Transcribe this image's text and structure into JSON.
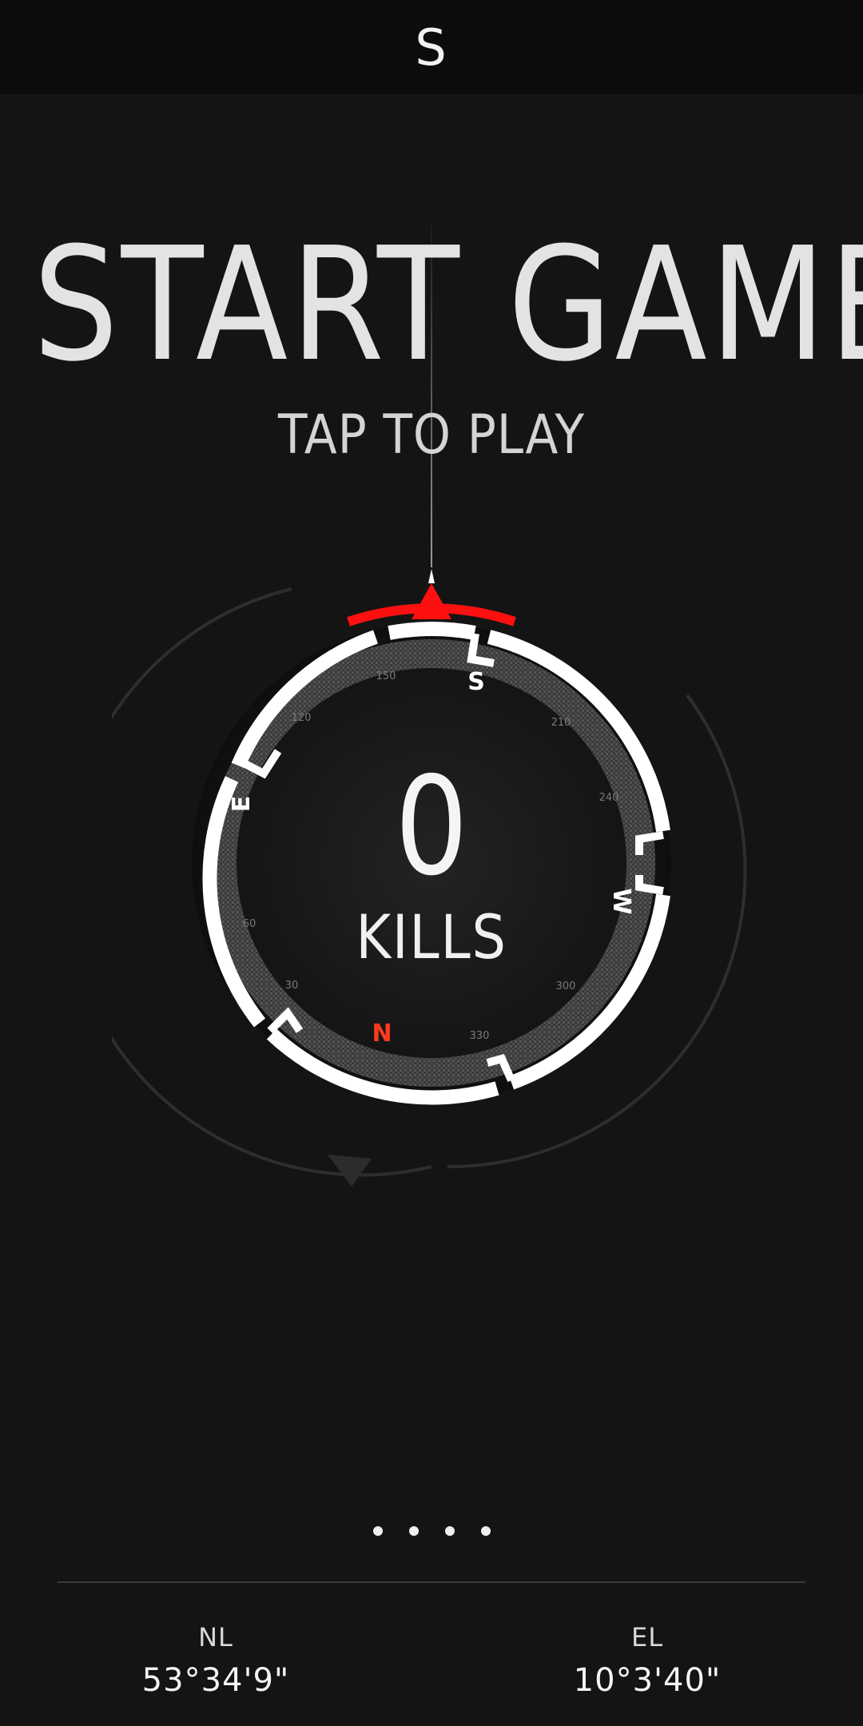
{
  "header": {
    "heading_letter": "S"
  },
  "title": "START GAME",
  "subtitle": "TAP TO PLAY",
  "compass": {
    "letters": {
      "top": "S",
      "left": "E",
      "right": "W",
      "bottom": "N"
    },
    "degree_labels": {
      "upper_left_1": "150",
      "upper_left_2": "120",
      "upper_right_1": "210",
      "upper_right_2": "240",
      "lower_left_1": "60",
      "lower_left_2": "30",
      "lower_right_1": "300",
      "lower_right_2": "330"
    },
    "colors": {
      "pointer": "#ff1010",
      "north": "#ff3b1f",
      "ring": "#ffffff",
      "face": "#1e1e1e"
    }
  },
  "score": {
    "value": "0",
    "label": "KILLS"
  },
  "pager": {
    "count": 4
  },
  "coordinates": {
    "left": {
      "label": "NL",
      "value": "53°34'9\""
    },
    "right": {
      "label": "EL",
      "value": "10°3'40\""
    }
  }
}
